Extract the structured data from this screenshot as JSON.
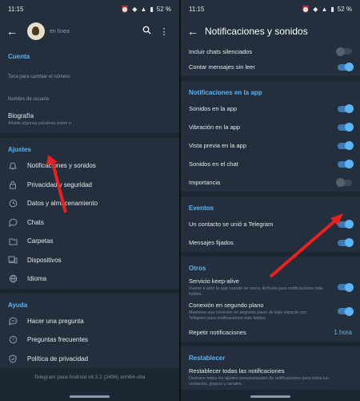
{
  "status": {
    "time": "11:15",
    "battery": "52 %"
  },
  "left": {
    "appbar": {
      "subtitle": "en línea"
    },
    "account": {
      "header": "Cuenta",
      "phone_hint": "Toca para cambiar el número",
      "username_hint": "Nombre de usuario",
      "bio_title": "Biografía",
      "bio_hint": "Añade algunas palabras sobre ti"
    },
    "settings": {
      "header": "Ajustes",
      "items": [
        {
          "label": "Notificaciones y sonidos",
          "icon": "bell-icon"
        },
        {
          "label": "Privacidad y seguridad",
          "icon": "lock-icon"
        },
        {
          "label": "Datos y almacenamiento",
          "icon": "clock-icon"
        },
        {
          "label": "Chats",
          "icon": "chat-icon"
        },
        {
          "label": "Carpetas",
          "icon": "folder-icon"
        },
        {
          "label": "Dispositivos",
          "icon": "device-icon"
        },
        {
          "label": "Idioma",
          "icon": "globe-icon"
        }
      ]
    },
    "help": {
      "header": "Ayuda",
      "items": [
        {
          "label": "Hacer una pregunta",
          "icon": "chat-icon"
        },
        {
          "label": "Preguntas frecuentes",
          "icon": "help-icon"
        },
        {
          "label": "Política de privacidad",
          "icon": "shield-icon"
        }
      ]
    },
    "footer": "Telegram para Android v8.3.2 (2496) arm64-v8a"
  },
  "right": {
    "title": "Notificaciones y sonidos",
    "top_rows": [
      {
        "label": "Incluir chats silenciados",
        "on": false
      },
      {
        "label": "Contar mensajes sin leer",
        "on": true
      }
    ],
    "in_app": {
      "header": "Notificaciones en la app",
      "rows": [
        {
          "label": "Sonidos en la app",
          "on": true
        },
        {
          "label": "Vibración en la app",
          "on": true
        },
        {
          "label": "Vista previa en la app",
          "on": true
        },
        {
          "label": "Sonidos en el chat",
          "on": true
        },
        {
          "label": "Importancia",
          "on": false
        }
      ]
    },
    "events": {
      "header": "Eventos",
      "rows": [
        {
          "label": "Un contacto se unió a Telegram",
          "on": true
        },
        {
          "label": "Mensajes fijados",
          "on": true
        }
      ]
    },
    "others": {
      "header": "Otros",
      "keepalive": {
        "label": "Servicio keep-alive",
        "desc": "Vuelve a abrir la app cuando se cierra. Actívala para notificaciones más fiables.",
        "on": true
      },
      "background": {
        "label": "Conexión en segundo plano",
        "desc": "Mantiene una conexión en segundo plano de bajo impacto con Telegram para notificaciones más fiables.",
        "on": true
      },
      "repeat": {
        "label": "Repetir notificaciones",
        "value": "1 hora"
      }
    },
    "reset": {
      "header": "Restablecer",
      "label": "Restablecer todas las notificaciones",
      "desc": "Deshace todos los ajustes personalizados de notificaciones para todos tus contactos, grupos y canales."
    }
  },
  "colors": {
    "background": "#1d2733",
    "section": "#232f3c",
    "accent": "#5cb3f5",
    "annotation_arrow": "#e8201e"
  }
}
